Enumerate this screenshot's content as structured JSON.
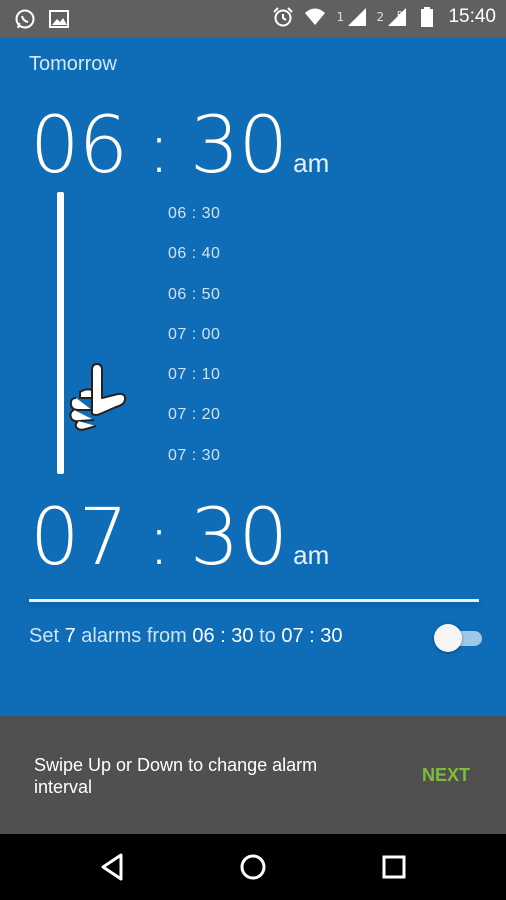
{
  "status_bar": {
    "left_icons": [
      "whatsapp-icon",
      "image-icon"
    ],
    "right_icons": [
      "alarm-icon",
      "wifi-icon",
      "signal-sim1-icon",
      "signal-sim2-icon",
      "battery-icon"
    ],
    "sim1_label": "1",
    "sim2_label": "2",
    "time": "15:40"
  },
  "alarm": {
    "day_label": "Tomorrow",
    "start": {
      "hours": "06",
      "separator": ":",
      "minutes": "30",
      "ampm": "am"
    },
    "end": {
      "hours": "07",
      "separator": ":",
      "minutes": "30",
      "ampm": "am"
    },
    "intervals": [
      "06 : 30",
      "06 : 40",
      "06 : 50",
      "07 : 00",
      "07 : 10",
      "07 : 20",
      "07 : 30"
    ],
    "summary": {
      "prefix": "Set ",
      "count": "7",
      "mid1": " alarms from ",
      "from": "06 : 30",
      "mid2": " to ",
      "to": "07 : 30"
    },
    "toggle_on": false
  },
  "hint": {
    "text": "Swipe Up or Down to change alarm interval",
    "next_label": "NEXT"
  },
  "nav": [
    "back-icon",
    "home-icon",
    "recents-icon"
  ],
  "colors": {
    "main_bg": "#0f6cb6",
    "hint_bg": "#505050",
    "next": "#7dbd3b",
    "status_bar": "#606060"
  }
}
